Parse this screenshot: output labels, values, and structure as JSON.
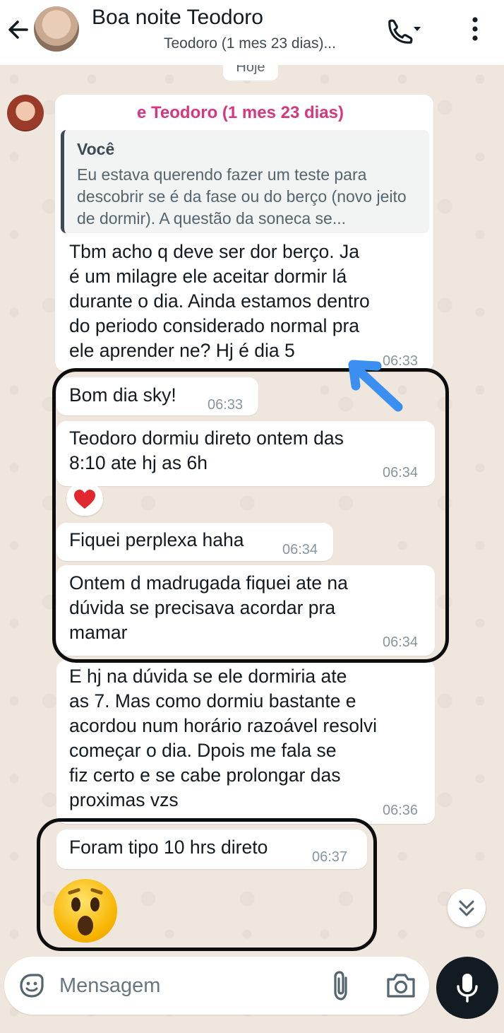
{
  "header": {
    "title": "Boa noite Teodoro",
    "subtitle": "Teodoro (1 mes 23 dias)..."
  },
  "date_chip": "Hoje",
  "input": {
    "placeholder": "Mensagem"
  },
  "messages": [
    {
      "sender": "e Teodoro (1 mes 23 dias)",
      "quote_author": "Você",
      "quote_text": "Eu estava querendo fazer um teste para descobrir se é da fase ou do berço (novo jeito de dormir). A questão da soneca se...",
      "text": "Tbm acho q deve ser dor berço. Ja\né um milagre ele aceitar dormir lá\ndurante o dia. Ainda estamos dentro\ndo periodo considerado normal pra\nele aprender ne? Hj é dia 5",
      "time": "06:33"
    },
    {
      "text": "Bom dia sky!",
      "time": "06:33"
    },
    {
      "text": "Teodoro dormiu direto ontem das\n8:10 ate hj as 6h",
      "time": "06:34",
      "reaction": "heart"
    },
    {
      "text": "Fiquei perplexa haha",
      "time": "06:34"
    },
    {
      "text": "Ontem d madrugada fiquei ate na\ndúvida se precisava acordar pra\nmamar",
      "time": "06:34"
    },
    {
      "text": "E hj na dúvida se ele dormiria ate\nas 7. Mas como dormiu bastante e\nacordou num horário razoável resolvi\ncomeçar o dia. Dpois me fala se\nfiz certo e se cabe prolongar das\nproximas vzs",
      "time": "06:36"
    },
    {
      "text": "Foram tipo 10 hrs direto",
      "time": "06:37"
    },
    {
      "emoji": "astonished-face"
    }
  ],
  "colors": {
    "sender_name": "#d6377e",
    "chat_background": "#efe7dd",
    "annotation_arrow": "#3b8ff0",
    "annotation_outline": "#0d0d0d"
  }
}
